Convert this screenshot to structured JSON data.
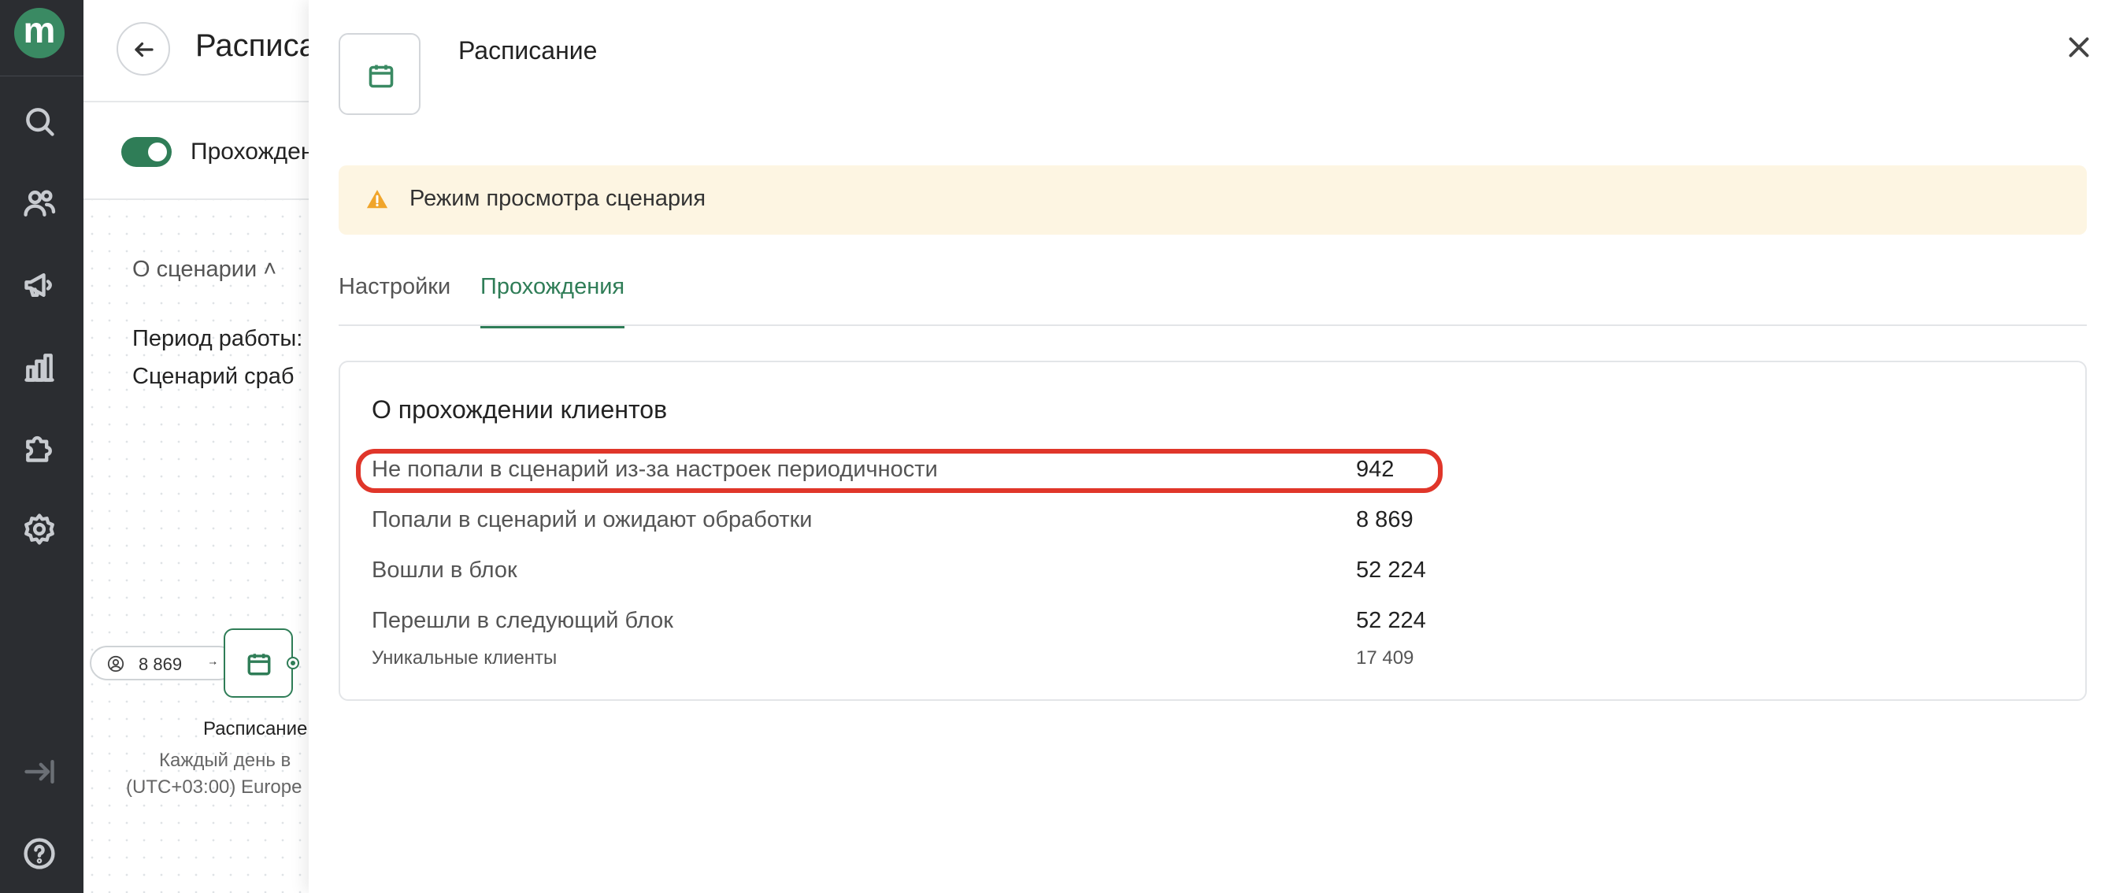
{
  "nav": {
    "logo_letter": "m",
    "icons": [
      "search-icon",
      "users-icon",
      "megaphone-icon",
      "analytics-icon",
      "puzzle-icon",
      "settings-icon",
      "expand-icon",
      "help-icon"
    ]
  },
  "background": {
    "page_title": "Расписа",
    "toggle_label": "Прохожден",
    "about_label": "О сценарии ˄",
    "period_label": "Период работы:",
    "scenario_label": "Сценарий сраб",
    "entry_count": "8 869",
    "node_title": "Расписание",
    "node_subtitle_1": "Каждый день в",
    "node_subtitle_2": "(UTC+03:00) Europe"
  },
  "drawer": {
    "title": "Расписание",
    "warning": "Режим просмотра сценария",
    "tabs": [
      {
        "label": "Настройки",
        "active": false
      },
      {
        "label": "Прохождения",
        "active": true
      }
    ],
    "card": {
      "title": "О прохождении клиентов",
      "rows": [
        {
          "label": "Не попали в сценарий из-за настроек периодичности",
          "value": "942"
        },
        {
          "label": "Попали в сценарий и ожидают обработки",
          "value": "8 869"
        },
        {
          "label": "Вошли в блок",
          "value": "52 224"
        },
        {
          "label": "Перешли в следующий блок",
          "value": "52 224"
        }
      ],
      "sub": {
        "label": "Уникальные клиенты",
        "value": "17 409"
      }
    }
  },
  "colors": {
    "accent": "#2f7d57",
    "rail": "#2b2d31",
    "warning_bg": "#fdf5e2",
    "warning_icon": "#f0a52b",
    "highlight": "#e0362a"
  }
}
